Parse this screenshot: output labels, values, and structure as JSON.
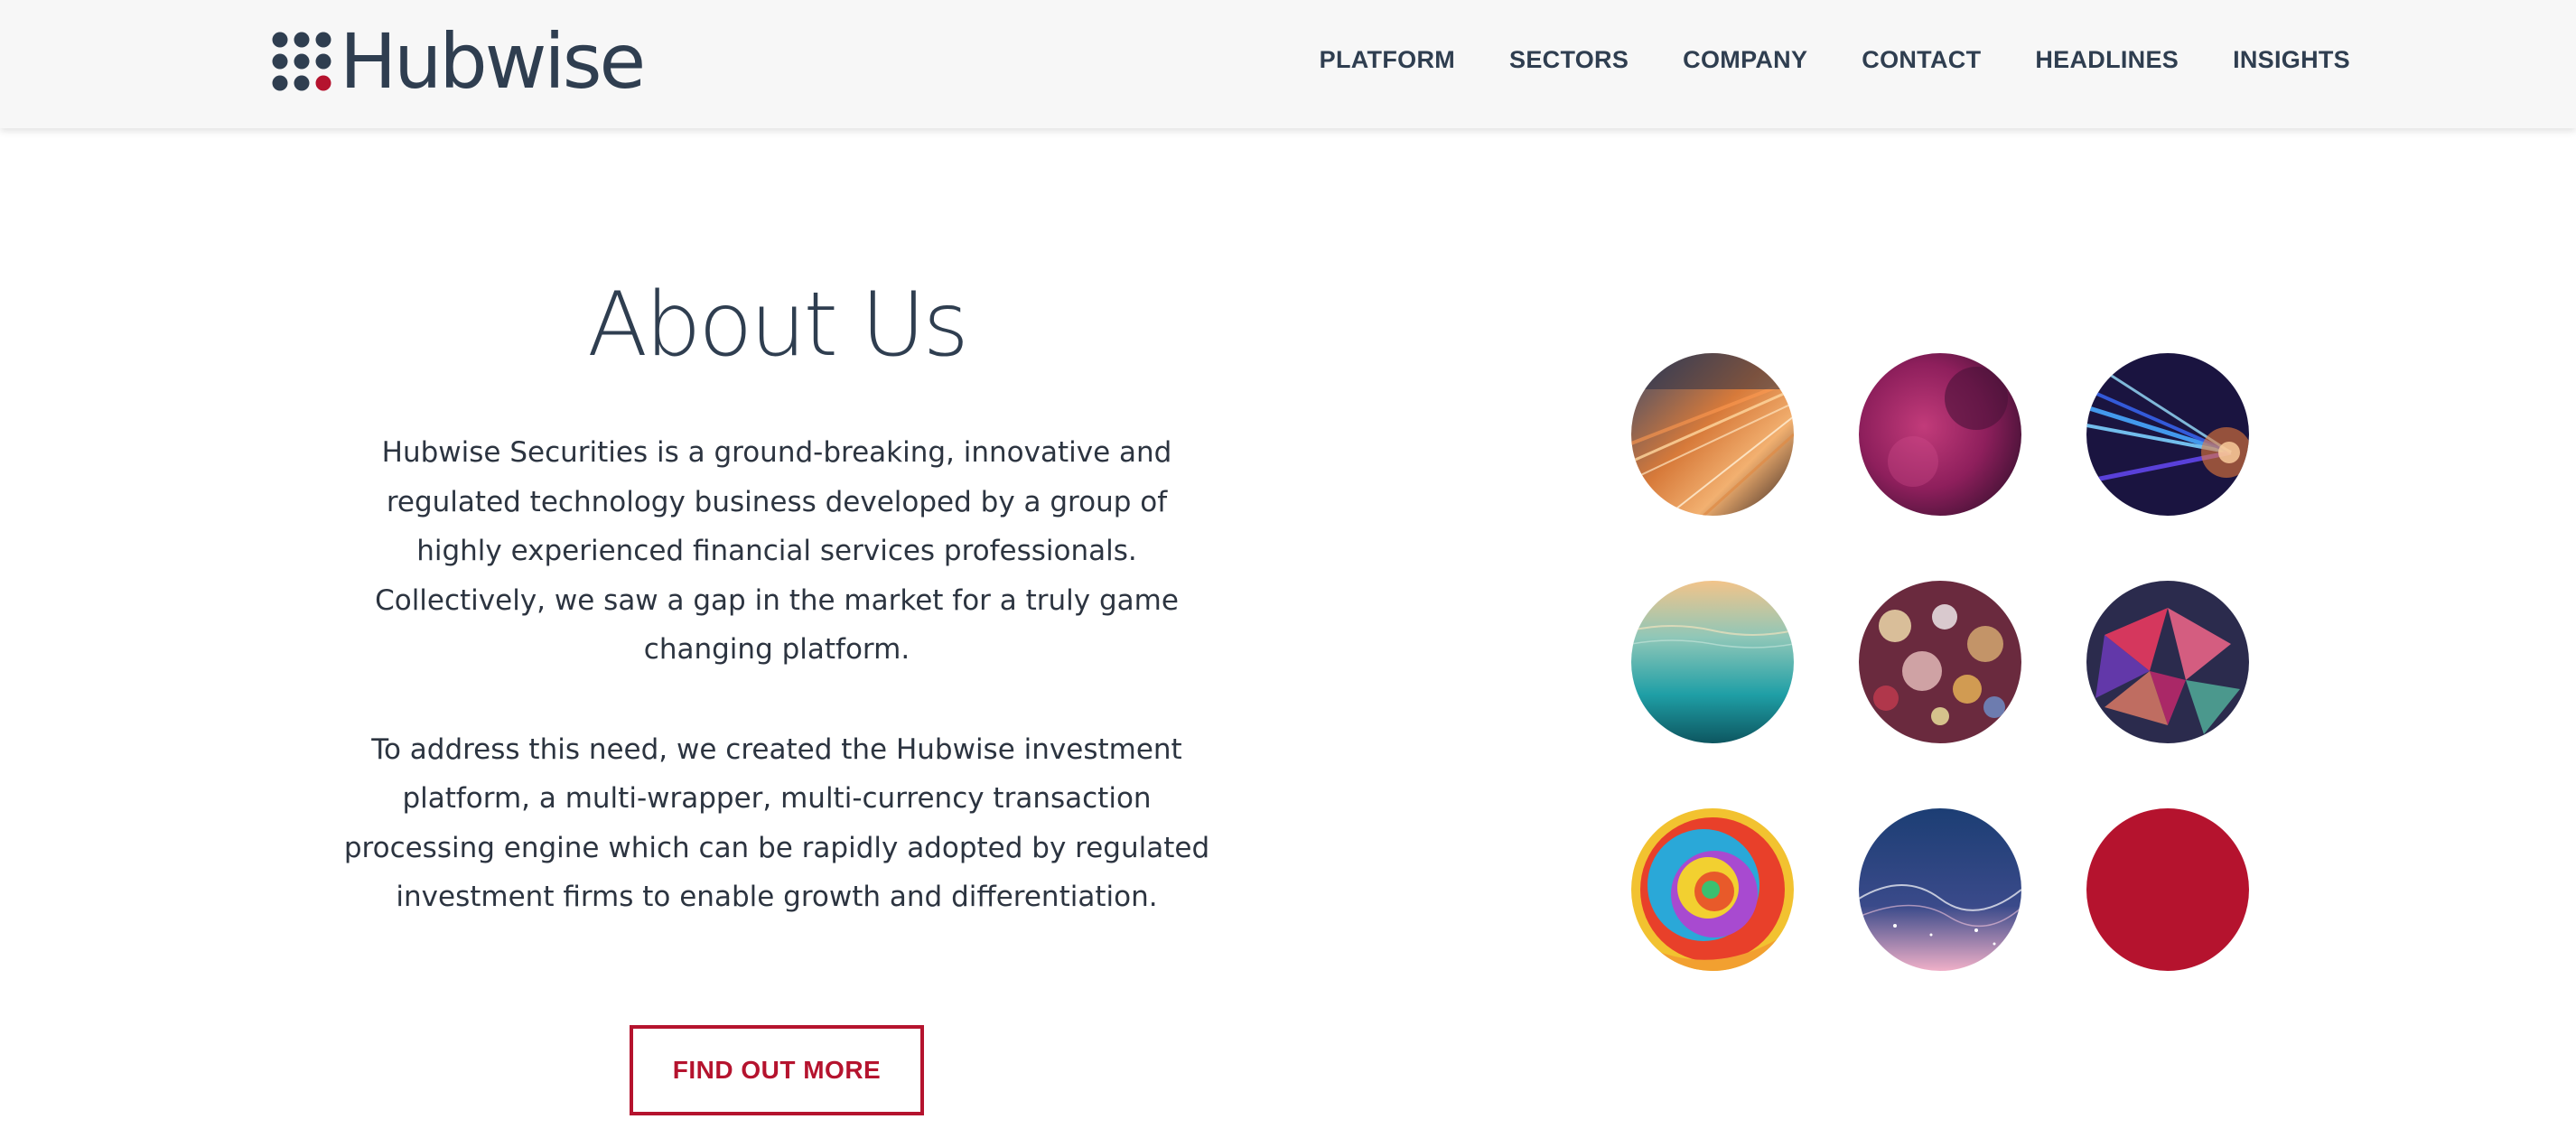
{
  "header": {
    "logo_text": "Hubwise",
    "nav": [
      "PLATFORM",
      "SECTORS",
      "COMPANY",
      "CONTACT",
      "HEADLINES",
      "INSIGHTS"
    ]
  },
  "about": {
    "title": "About Us",
    "paragraphs": [
      "Hubwise Securities is a ground-breaking, innovative and regulated technology business developed by a group of highly experienced financial services professionals. Collectively, we saw a gap in the market for a truly game changing platform.",
      "To address this need, we created the Hubwise investment platform, a multi-wrapper, multi-currency transaction processing engine which can be rapidly adopted by regulated investment firms to enable growth and differentiation."
    ],
    "cta_label": "FIND OUT MORE"
  },
  "circles": [
    {
      "icon": "light-trails-image"
    },
    {
      "icon": "magenta-nebula-image"
    },
    {
      "icon": "light-tunnel-image"
    },
    {
      "icon": "underwater-image"
    },
    {
      "icon": "bokeh-lights-image"
    },
    {
      "icon": "polygon-crystal-image"
    },
    {
      "icon": "rainbow-rose-image"
    },
    {
      "icon": "particle-wave-image"
    },
    {
      "icon": "red-circle",
      "color": "#b5132e"
    }
  ],
  "colors": {
    "brand_navy": "#2f3e50",
    "brand_red": "#b5132e",
    "header_bg": "#f7f7f7"
  }
}
